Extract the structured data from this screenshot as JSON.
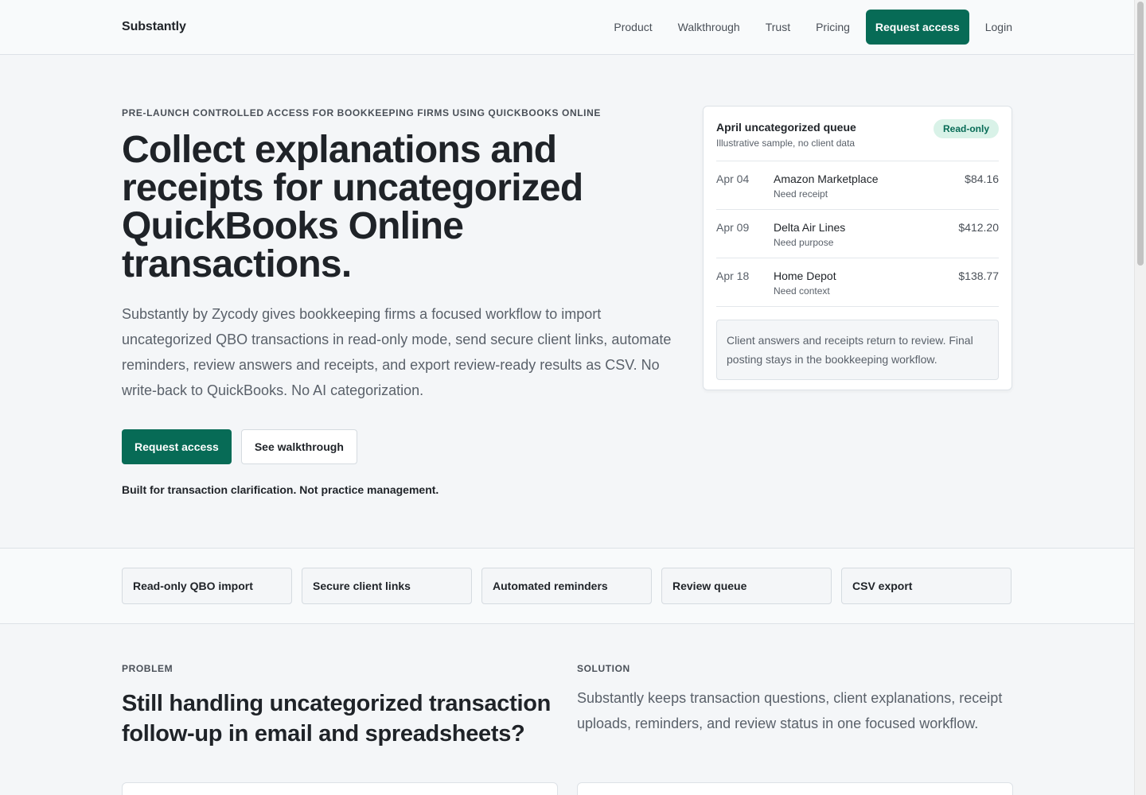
{
  "header": {
    "brand": "Substantly",
    "nav": [
      "Product",
      "Walkthrough",
      "Trust",
      "Pricing"
    ],
    "cta": "Request access",
    "login": "Login"
  },
  "hero": {
    "eyebrow": "PRE-LAUNCH CONTROLLED ACCESS FOR BOOKKEEPING FIRMS USING QUICKBOOKS ONLINE",
    "title": "Collect explanations and receipts for uncategorized QuickBooks Online transactions.",
    "text": "Substantly by Zycody gives bookkeeping firms a focused workflow to import uncategorized QBO transactions in read-only mode, send secure client links, automate reminders, review answers and receipts, and export review-ready results as CSV. No write-back to QuickBooks. No AI categorization.",
    "primary_button": "Request access",
    "secondary_button": "See walkthrough",
    "note": "Built for transaction clarification. Not practice management."
  },
  "queue": {
    "title": "April uncategorized queue",
    "subtitle": "Illustrative sample, no client data",
    "badge": "Read-only",
    "rows": [
      {
        "date": "Apr 04",
        "vendor": "Amazon Marketplace",
        "need": "Need receipt",
        "amount": "$84.16"
      },
      {
        "date": "Apr 09",
        "vendor": "Delta Air Lines",
        "need": "Need purpose",
        "amount": "$412.20"
      },
      {
        "date": "Apr 18",
        "vendor": "Home Depot",
        "need": "Need context",
        "amount": "$138.77"
      }
    ],
    "note": "Client answers and receipts return to review. Final posting stays in the bookkeeping workflow."
  },
  "features": [
    "Read-only QBO import",
    "Secure client links",
    "Automated reminders",
    "Review queue",
    "CSV export"
  ],
  "problem": {
    "label": "PROBLEM",
    "title": "Still handling uncategorized transaction follow-up in email and spreadsheets?"
  },
  "solution": {
    "label": "SOLUTION",
    "text": "Substantly keeps transaction questions, client explanations, receipt uploads, reminders, and review status in one focused workflow."
  }
}
